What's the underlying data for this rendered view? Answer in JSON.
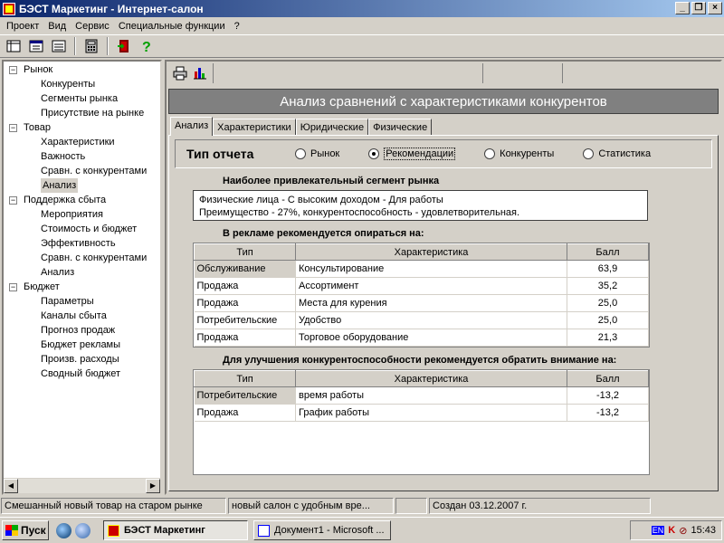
{
  "window": {
    "title": "БЭСТ Маркетинг - Интернет-салон",
    "controls": [
      "_",
      "❐",
      "×"
    ]
  },
  "menu": [
    "Проект",
    "Вид",
    "Сервис",
    "Специальные функции",
    "?"
  ],
  "toolbar": {
    "icons": [
      "table-view-icon",
      "form-view-icon",
      "list-view-icon",
      "calculator-icon",
      "exit-icon",
      "help-icon"
    ]
  },
  "tree": {
    "nodes": [
      {
        "label": "Рынок",
        "level": 0,
        "expander": "−"
      },
      {
        "label": "Конкуренты",
        "level": 1
      },
      {
        "label": "Сегменты рынка",
        "level": 1
      },
      {
        "label": "Присутствие на рынке",
        "level": 1
      },
      {
        "label": "Товар",
        "level": 0,
        "expander": "−"
      },
      {
        "label": "Характеристики",
        "level": 1
      },
      {
        "label": "Важность",
        "level": 1
      },
      {
        "label": "Сравн. с конкурентами",
        "level": 1
      },
      {
        "label": "Анализ",
        "level": 1,
        "selected": true
      },
      {
        "label": "Поддержка сбыта",
        "level": 0,
        "expander": "−"
      },
      {
        "label": "Мероприятия",
        "level": 1
      },
      {
        "label": "Стоимость и бюджет",
        "level": 1
      },
      {
        "label": "Эффективность",
        "level": 1
      },
      {
        "label": "Сравн. с конкурентами",
        "level": 1
      },
      {
        "label": "Анализ",
        "level": 1
      },
      {
        "label": "Бюджет",
        "level": 0,
        "expander": "−"
      },
      {
        "label": "Параметры",
        "level": 1
      },
      {
        "label": "Каналы сбыта",
        "level": 1
      },
      {
        "label": "Прогноз продаж",
        "level": 1
      },
      {
        "label": "Бюджет рекламы",
        "level": 1
      },
      {
        "label": "Произв. расходы",
        "level": 1
      },
      {
        "label": "Сводный бюджет",
        "level": 1
      }
    ]
  },
  "main": {
    "banner": "Анализ сравнений с характеристиками конкурентов",
    "tabs": [
      "Анализ",
      "Характеристики",
      "Юридические",
      "Физические"
    ],
    "report": {
      "label": "Тип отчета",
      "options": [
        "Рынок",
        "Рекомендации",
        "Конкуренты",
        "Статистика"
      ],
      "selected": "Рекомендации"
    },
    "segment": {
      "title": "Наиболее привлекательный сегмент рынка",
      "line1": "Физические лица - С высоким доходом - Для работы",
      "line2": "Преимущество - 27%,  конкурентоспособность - удовлетворительная."
    },
    "advert": {
      "title": "В рекламе рекомендуется опираться на:",
      "headers": [
        "Тип",
        "Характеристика",
        "Балл"
      ],
      "rows": [
        [
          "Обслуживание",
          "Консультирование",
          "63,9"
        ],
        [
          "Продажа",
          "Ассортимент",
          "35,2"
        ],
        [
          "Продажа",
          "Места для курения",
          "25,0"
        ],
        [
          "Потребительские",
          "Удобство",
          "25,0"
        ],
        [
          "Продажа",
          "Торговое оборудование",
          "21,3"
        ]
      ]
    },
    "improve": {
      "title": "Для улучшения конкурентоспособности рекомендуется обратить внимание на:",
      "headers": [
        "Тип",
        "Характеристика",
        "Балл"
      ],
      "rows": [
        [
          "Потребительские",
          "время работы",
          "-13,2"
        ],
        [
          "Продажа",
          "График работы",
          "-13,2"
        ]
      ]
    }
  },
  "status": {
    "p1": "Смешанный новый товар на старом рынке",
    "p2": "новый салон с удобным вре...",
    "p3": "",
    "p4": "Создан 03.12.2007 г."
  },
  "taskbar": {
    "start": "Пуск",
    "tasks": [
      "БЭСТ Маркетинг",
      "Документ1 - Microsoft ..."
    ],
    "lang": "EN",
    "clock": "15:43"
  }
}
